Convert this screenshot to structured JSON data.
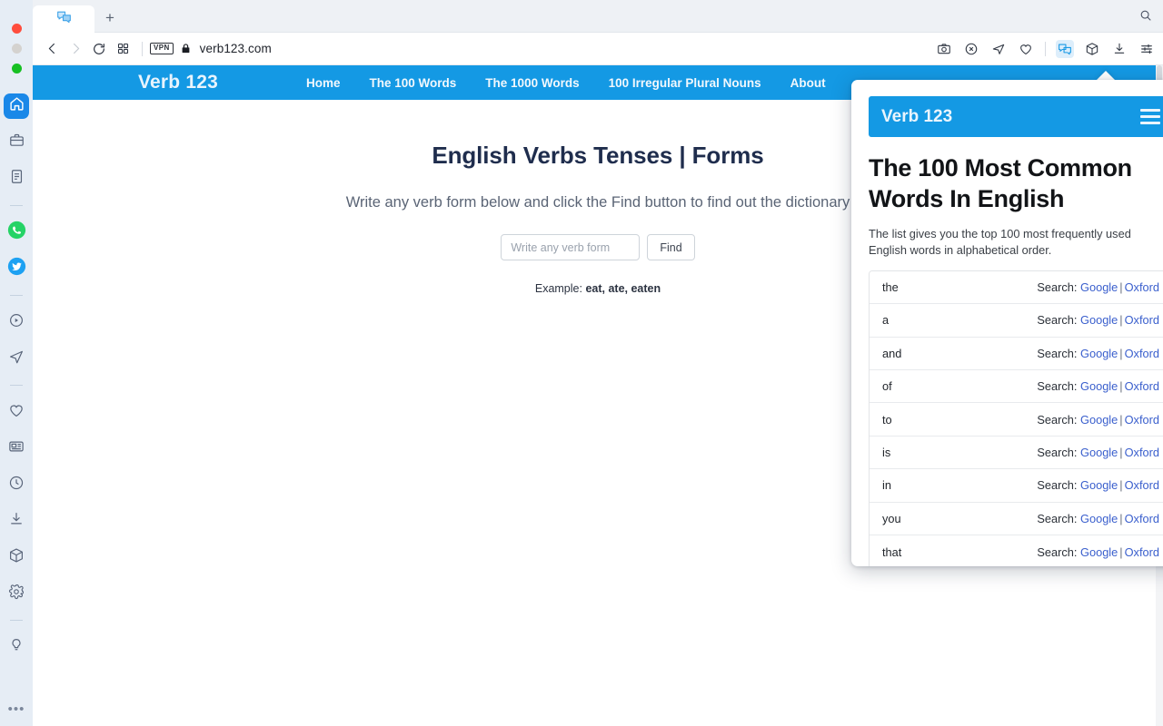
{
  "dock": {
    "items": [
      {
        "name": "home-icon",
        "label": "Home",
        "active": true
      },
      {
        "name": "briefcase-icon",
        "label": "Work"
      },
      {
        "name": "document-icon",
        "label": "Notes"
      },
      {
        "name": "whatsapp-icon",
        "label": "WhatsApp"
      },
      {
        "name": "twitter-icon",
        "label": "Twitter"
      },
      {
        "name": "video-play-icon",
        "label": "Video"
      },
      {
        "name": "telegram-send-icon",
        "label": "Send"
      },
      {
        "name": "heart-icon",
        "label": "Favorites"
      },
      {
        "name": "news-icon",
        "label": "News"
      },
      {
        "name": "clock-icon",
        "label": "History"
      },
      {
        "name": "download-icon",
        "label": "Downloads"
      },
      {
        "name": "cube-icon",
        "label": "Extensions"
      },
      {
        "name": "gear-icon",
        "label": "Settings"
      },
      {
        "name": "bulb-icon",
        "label": "Tips"
      }
    ],
    "more_label": "•••"
  },
  "browser": {
    "tab": {
      "title": "",
      "favicon": "translate-icon"
    },
    "new_tab_label": "+",
    "back_label": "‹",
    "forward_label": "›",
    "reload_label": "↻",
    "vpn_label": "VPN",
    "url": "verb123.com",
    "toolbar_icons": [
      "camera-icon",
      "shield-x-icon",
      "send-icon",
      "heart-icon",
      "translate-extension-icon",
      "cube-icon",
      "download-icon",
      "sliders-icon"
    ],
    "search_icon": "search-icon"
  },
  "site": {
    "brand": "Verb 123",
    "nav": [
      "Home",
      "The 100 Words",
      "The 1000 Words",
      "100 Irregular Plural Nouns",
      "About"
    ],
    "heading": "English Verbs Tenses | Forms",
    "lead": "Write any verb form below and click the Find button to find out the dictionary",
    "input_placeholder": "Write any verb form",
    "input_value": "",
    "find_label": "Find",
    "example_prefix": "Example: ",
    "example_words": "eat, ate, eaten"
  },
  "popup": {
    "brand": "Verb 123",
    "menu_icon": "hamburger-menu-icon",
    "heading": "The 100 Most Common Words In English",
    "subtitle": "The list gives you the top 100 most frequently used English words in alphabetical order.",
    "search_label": "Search:",
    "google_label": "Google",
    "separator": "|",
    "oxford_label": "Oxford",
    "words": [
      "the",
      "a",
      "and",
      "of",
      "to",
      "is",
      "in",
      "you",
      "that"
    ]
  },
  "colors": {
    "brand_blue": "#1499e4",
    "link_blue": "#3a5fcd",
    "heading_navy": "#1f2d4d",
    "dock_bg": "#e6edf5"
  }
}
